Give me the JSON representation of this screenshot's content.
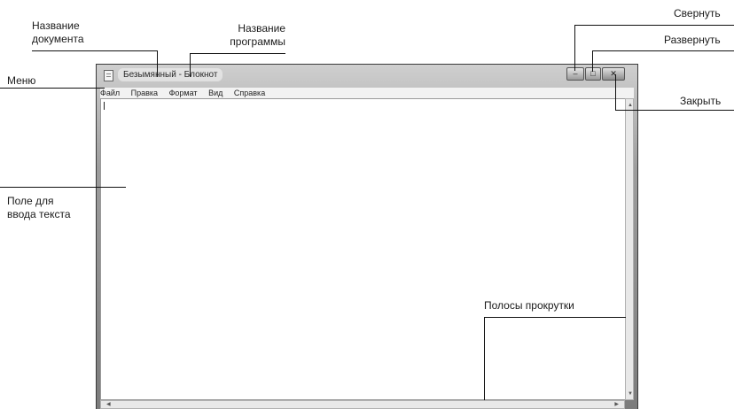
{
  "callouts": {
    "doc_name": "Название\nдокумента",
    "prog_name": "Название\nпрограммы",
    "menu": "Меню",
    "text_field": "Поле для\nввода текста",
    "scrollbars": "Полосы прокрутки",
    "minimize": "Свернуть",
    "maximize": "Развернуть",
    "close": "Закрыть"
  },
  "window": {
    "title": "Безымянный - Блокнот",
    "menu": [
      "Файл",
      "Правка",
      "Формат",
      "Вид",
      "Справка"
    ],
    "close_glyph": "✕",
    "maximize_glyph": "□",
    "minimize_glyph": "–",
    "scroll_up": "▲",
    "scroll_down": "▼",
    "scroll_left": "◀",
    "scroll_right": "▶"
  }
}
